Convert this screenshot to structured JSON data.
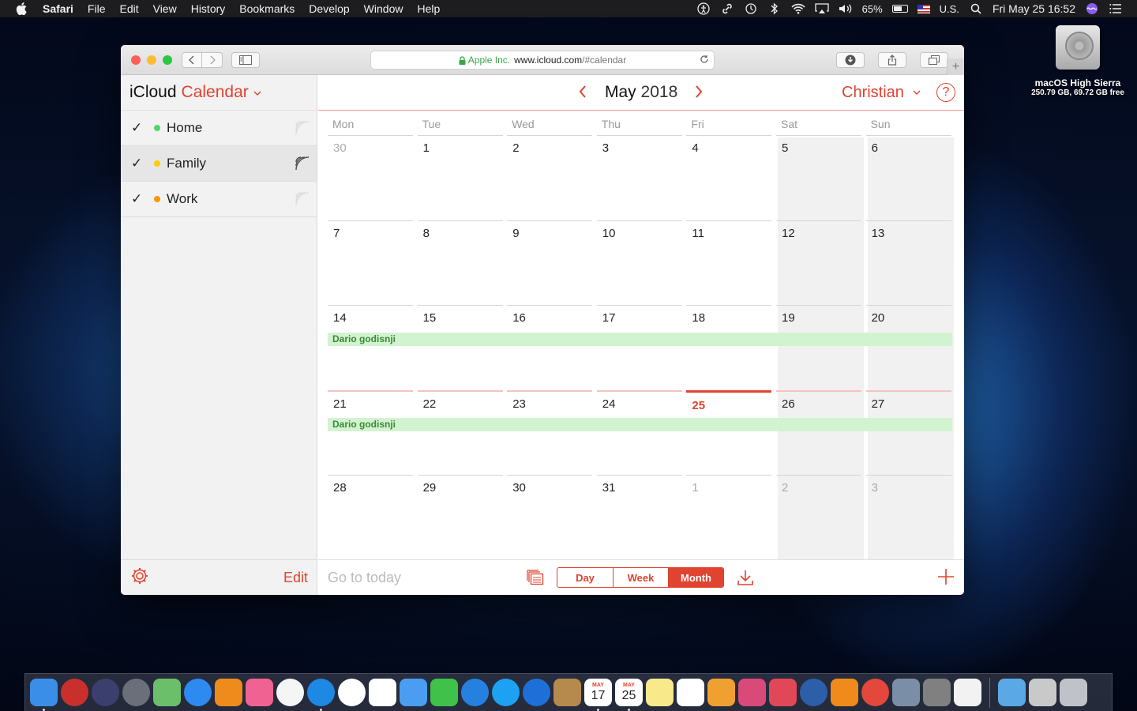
{
  "menubar": {
    "app_name": "Safari",
    "menus": [
      "File",
      "Edit",
      "View",
      "History",
      "Bookmarks",
      "Develop",
      "Window",
      "Help"
    ],
    "battery": "65%",
    "input_source": "U.S.",
    "clock": "Fri May 25  16:52"
  },
  "desktop": {
    "drive_name": "macOS High Sierra",
    "drive_size": "250.79 GB, 69.72 GB free"
  },
  "browser": {
    "secure_label": "Apple Inc.",
    "url_host": "www.icloud.com",
    "url_path": "/#calendar"
  },
  "sidebar": {
    "brand": "iCloud",
    "app": "Calendar",
    "calendars": [
      {
        "name": "Home",
        "color": "#4cd964",
        "checked": true
      },
      {
        "name": "Family",
        "color": "#ffcc00",
        "checked": true
      },
      {
        "name": "Work",
        "color": "#ff9500",
        "checked": true
      }
    ],
    "edit_label": "Edit"
  },
  "calendar": {
    "month": "May",
    "year": "2018",
    "user": "Christian",
    "help": "?",
    "weekdays": [
      "Mon",
      "Tue",
      "Wed",
      "Thu",
      "Fri",
      "Sat",
      "Sun"
    ],
    "weeks": [
      [
        "30",
        "1",
        "2",
        "3",
        "4",
        "5",
        "6"
      ],
      [
        "7",
        "8",
        "9",
        "10",
        "11",
        "12",
        "13"
      ],
      [
        "14",
        "15",
        "16",
        "17",
        "18",
        "19",
        "20"
      ],
      [
        "21",
        "22",
        "23",
        "24",
        "25",
        "26",
        "27"
      ],
      [
        "28",
        "29",
        "30",
        "31",
        "1",
        "2",
        "3"
      ]
    ],
    "today": "25",
    "events": [
      {
        "title": "Dario godisnji",
        "week": 2
      },
      {
        "title": "Dario godisnji",
        "week": 3
      }
    ],
    "accent_color": "#e0432f"
  },
  "footer": {
    "goto_today": "Go to today",
    "views": [
      "Day",
      "Week",
      "Month"
    ],
    "active_view": "Month"
  },
  "dock": {
    "icons": [
      "finder-icon",
      "photo-booth-icon",
      "siri-icon",
      "launchpad-icon",
      "maps-icon",
      "app-store-icon",
      "ibooks-icon",
      "itunes-icon",
      "photos-icon",
      "safari-icon",
      "chrome-icon",
      "slack-icon",
      "messages-icon",
      "facetime-icon",
      "tweetbot-icon",
      "twitter-icon",
      "testflight-icon",
      "notebook-icon",
      "calendar-icon",
      "calendar-alt-icon",
      "notes-icon",
      "reminders-icon",
      "preview-icon",
      "pixelmator-icon",
      "airmail-icon",
      "1password-icon",
      "vlc-icon",
      "pdf-expert-icon",
      "image-capture-icon",
      "system-preferences-icon",
      "textedit-icon",
      "downloads-folder-icon",
      "scanner-icon",
      "trash-icon"
    ],
    "calendar_month": "MAY",
    "calendar_day_1": "17",
    "calendar_day_2": "25"
  }
}
